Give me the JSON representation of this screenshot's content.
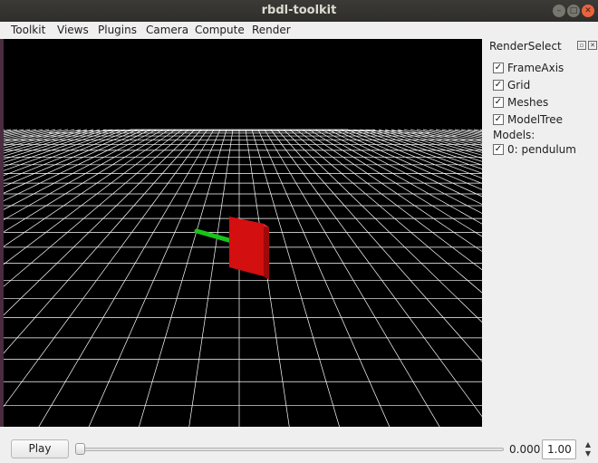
{
  "window": {
    "title": "rbdl-toolkit"
  },
  "menu": {
    "items": [
      "Toolkit",
      "Views",
      "Plugins",
      "Camera",
      "Compute",
      "Render"
    ]
  },
  "panel": {
    "title": "RenderSelect",
    "checkboxes": [
      {
        "label": "FrameAxis",
        "checked": true
      },
      {
        "label": "Grid",
        "checked": true
      },
      {
        "label": "Meshes",
        "checked": true
      },
      {
        "label": "ModelTree",
        "checked": true
      }
    ],
    "models_label": "Models:",
    "models": [
      {
        "label": "0: pendulum",
        "checked": true
      }
    ]
  },
  "bottom": {
    "play_label": "Play",
    "time_value": "0.000",
    "speed_value": "1.00",
    "slider_position": 0.0
  },
  "scene": {
    "grid_color": "#ffffff",
    "background": "#000000",
    "axis_color": "#19c419",
    "box_color": "#d40f0f"
  }
}
